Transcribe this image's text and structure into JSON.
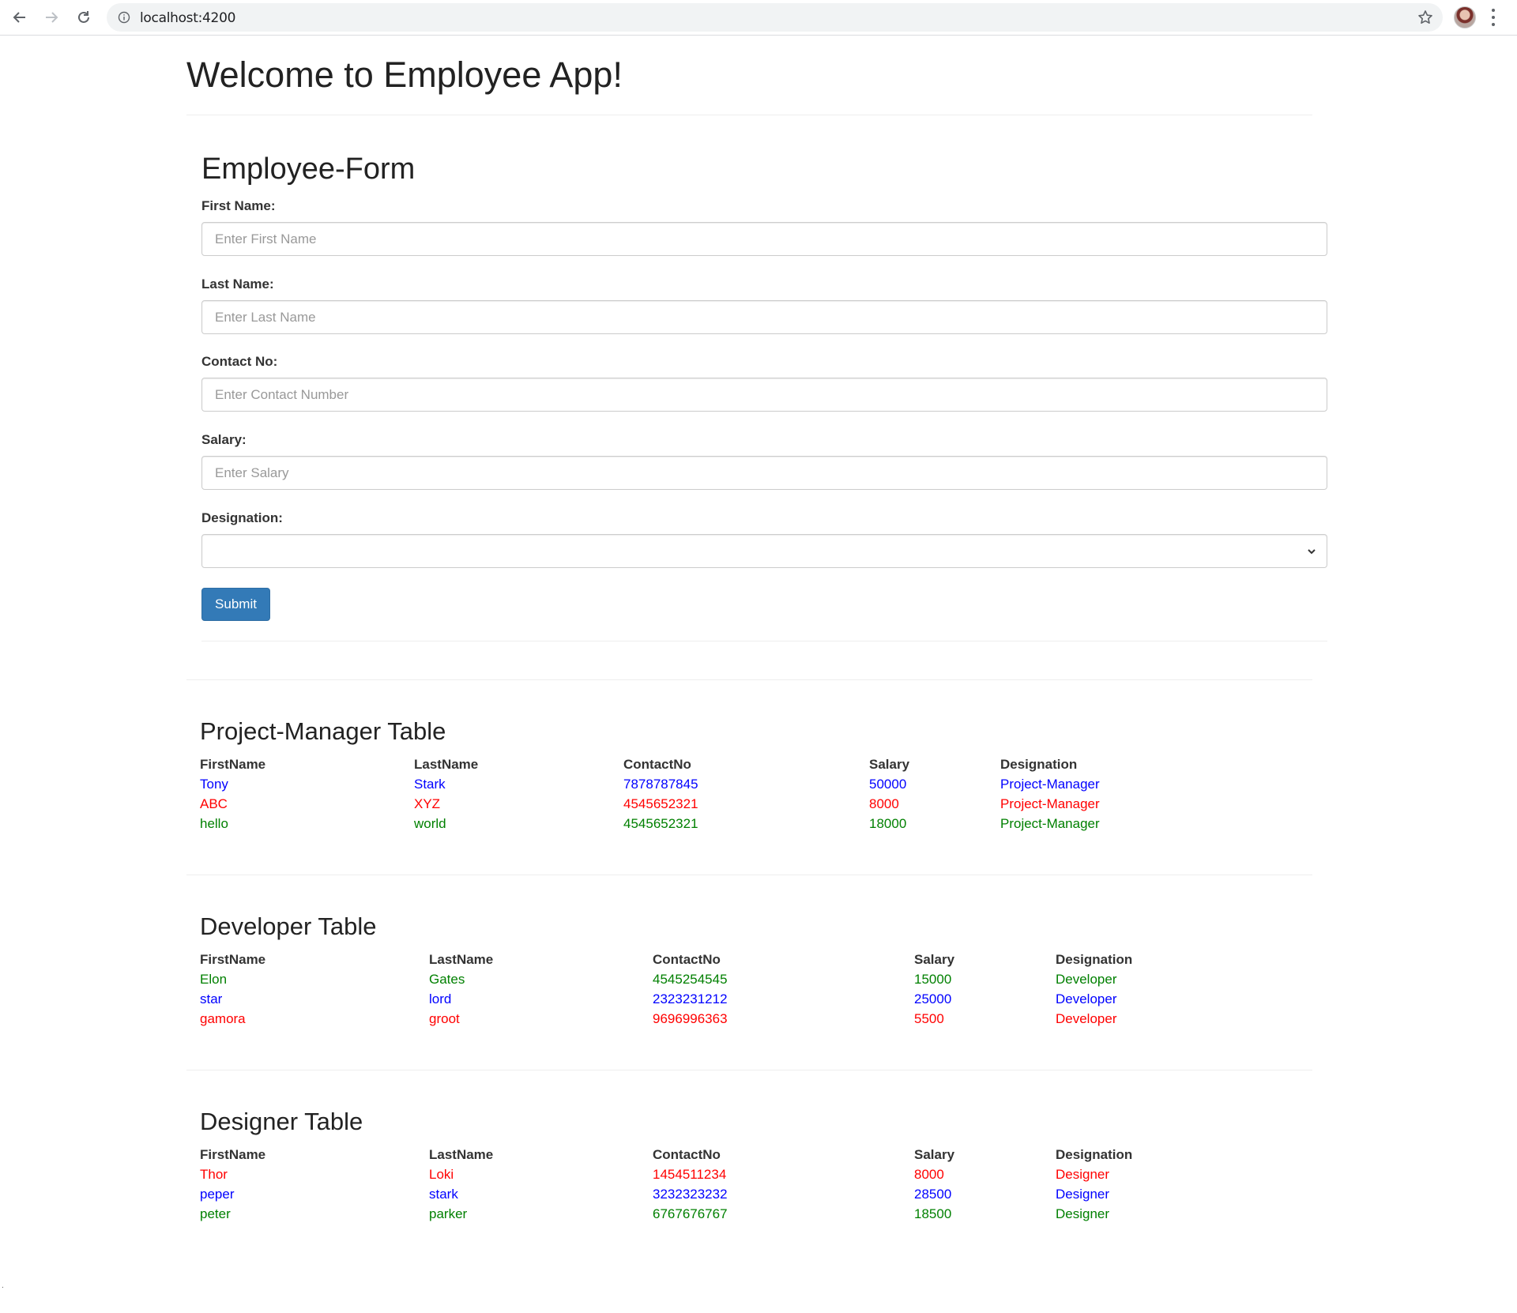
{
  "browser": {
    "url": "localhost:4200"
  },
  "app": {
    "title": "Welcome to Employee App!"
  },
  "form": {
    "title": "Employee-Form",
    "fields": [
      {
        "label": "First Name:",
        "placeholder": "Enter First Name",
        "value": ""
      },
      {
        "label": "Last Name:",
        "placeholder": "Enter Last Name",
        "value": ""
      },
      {
        "label": "Contact No:",
        "placeholder": "Enter Contact Number",
        "value": ""
      },
      {
        "label": "Salary:",
        "placeholder": "Enter Salary",
        "value": ""
      }
    ],
    "designation": {
      "label": "Designation:",
      "selected": ""
    },
    "submit_label": "Submit"
  },
  "colors": {
    "blue": "#0000ff",
    "red": "#ff0000",
    "green": "#008000",
    "primary_button": "#337ab7"
  },
  "tables": [
    {
      "title": "Project-Manager Table",
      "headers": [
        "FirstName",
        "LastName",
        "ContactNo",
        "Salary",
        "Designation"
      ],
      "rows": [
        {
          "color": "blue",
          "cells": [
            "Tony",
            "Stark",
            "7878787845",
            "50000",
            "Project-Manager"
          ]
        },
        {
          "color": "red",
          "cells": [
            "ABC",
            "XYZ",
            "4545652321",
            "8000",
            "Project-Manager"
          ]
        },
        {
          "color": "green",
          "cells": [
            "hello",
            "world",
            "4545652321",
            "18000",
            "Project-Manager"
          ]
        }
      ]
    },
    {
      "title": "Developer Table",
      "headers": [
        "FirstName",
        "LastName",
        "ContactNo",
        "Salary",
        "Designation"
      ],
      "rows": [
        {
          "color": "green",
          "cells": [
            "Elon",
            "Gates",
            "4545254545",
            "15000",
            "Developer"
          ]
        },
        {
          "color": "blue",
          "cells": [
            "star",
            "lord",
            "2323231212",
            "25000",
            "Developer"
          ]
        },
        {
          "color": "red",
          "cells": [
            "gamora",
            "groot",
            "9696996363",
            "5500",
            "Developer"
          ]
        }
      ]
    },
    {
      "title": "Designer Table",
      "headers": [
        "FirstName",
        "LastName",
        "ContactNo",
        "Salary",
        "Designation"
      ],
      "rows": [
        {
          "color": "red",
          "cells": [
            "Thor",
            "Loki",
            "1454511234",
            "8000",
            "Designer"
          ]
        },
        {
          "color": "blue",
          "cells": [
            "peper",
            "stark",
            "3232323232",
            "28500",
            "Designer"
          ]
        },
        {
          "color": "green",
          "cells": [
            "peter",
            "parker",
            "6767676767",
            "18500",
            "Designer"
          ]
        }
      ]
    }
  ],
  "footer": {
    "mark": "."
  }
}
